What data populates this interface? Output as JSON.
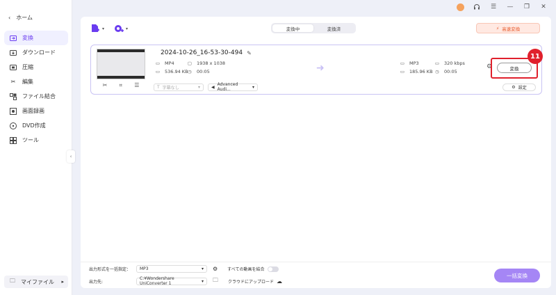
{
  "sidebar": {
    "home_label": "ホーム",
    "items": [
      {
        "label": "変換",
        "icon": "convert-icon",
        "active": true
      },
      {
        "label": "ダウンロード",
        "icon": "download-icon",
        "active": false
      },
      {
        "label": "圧縮",
        "icon": "compress-icon",
        "active": false
      },
      {
        "label": "編集",
        "icon": "scissors-icon",
        "active": false
      },
      {
        "label": "ファイル結合",
        "icon": "merge-icon",
        "active": false
      },
      {
        "label": "画面録画",
        "icon": "record-icon",
        "active": false
      },
      {
        "label": "DVD作成",
        "icon": "dvd-icon",
        "active": false
      },
      {
        "label": "ツール",
        "icon": "tools-icon",
        "active": false
      }
    ],
    "myfiles_label": "マイファイル"
  },
  "header": {
    "tabs": [
      "変換中",
      "変換済"
    ],
    "active_tab": 0,
    "fast_convert_label": "高速変換"
  },
  "file": {
    "name": "2024-10-26_16-53-30-494",
    "source": {
      "format": "MP4",
      "resolution": "1938 x 1038",
      "size": "536.94 KB",
      "duration": "00:05"
    },
    "target": {
      "format": "MP3",
      "bitrate": "320 kbps",
      "size": "185.96 KB",
      "duration": "00:05"
    },
    "convert_label": "変換",
    "subtitle_placeholder": "字幕なし",
    "audio_track": "Advanced Audi...",
    "settings_label": "設定"
  },
  "annotation": {
    "step_number": "11",
    "color": "#e0202c"
  },
  "bottom": {
    "output_format_label": "出力形式を一括指定：",
    "output_format_value": "MP3",
    "merge_label": "すべての動画を結合",
    "output_path_label": "出力先:",
    "output_path_value": "C:¥Wondershare UniConverter 1",
    "upload_label": "クラウドにアップロード",
    "batch_convert_label": "一括変換"
  },
  "colors": {
    "accent": "#6a3cf0",
    "batch_button": "#a586f5",
    "fast_convert": "#e85a2c"
  }
}
